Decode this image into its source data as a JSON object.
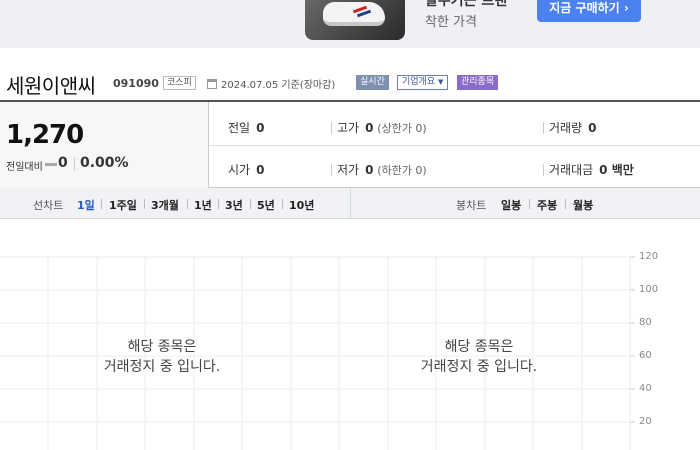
{
  "ad": {
    "headline": "탈수기는 브랜",
    "subtext": "착한 가격",
    "button_label": "지금 구매하기 ›"
  },
  "stock": {
    "name": "세원이앤씨",
    "code": "091090",
    "market": "코스피",
    "date": "2024.07.05 기준(장마감)",
    "tags": {
      "realtime": "실시간",
      "company_info": "기업개요",
      "management": "관리종목"
    }
  },
  "summary": {
    "price": "1,270",
    "change_label": "전일대비",
    "change_value": "0",
    "change_pct": "0.00%",
    "prev_close": {
      "label": "전일",
      "value": "0"
    },
    "high": {
      "label": "고가",
      "value": "0",
      "sub": "(상한가 0)"
    },
    "volume": {
      "label": "거래량",
      "value": "0"
    },
    "open": {
      "label": "시가",
      "value": "0"
    },
    "low": {
      "label": "저가",
      "value": "0",
      "sub": "(하한가 0)"
    },
    "trade_amount": {
      "label": "거래대금",
      "value": "0 백만"
    }
  },
  "line_chart_tabs": {
    "label": "선차트",
    "items": [
      "1일",
      "1주일",
      "3개월",
      "1년",
      "3년",
      "5년",
      "10년"
    ],
    "active": 0
  },
  "candle_chart_tabs": {
    "label": "봉차트",
    "items": [
      "일봉",
      "주봉",
      "월봉"
    ]
  },
  "chart": {
    "halt_line1": "해당 종목은",
    "halt_line2": "거래정지 중 입니다.",
    "y_ticks": [
      "120",
      "100",
      "80",
      "60",
      "40",
      "20"
    ]
  }
}
